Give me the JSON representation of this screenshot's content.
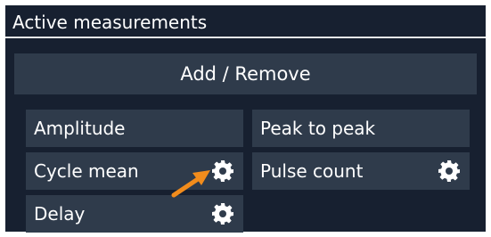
{
  "panel": {
    "title": "Active measurements"
  },
  "add_remove_label": "Add / Remove",
  "measurements": [
    {
      "label": "Amplitude",
      "has_settings": false
    },
    {
      "label": "Peak to peak",
      "has_settings": false
    },
    {
      "label": "Cycle mean",
      "has_settings": true
    },
    {
      "label": "Pulse count",
      "has_settings": true
    },
    {
      "label": "Delay",
      "has_settings": true
    }
  ],
  "colors": {
    "panel_background": "#172030",
    "button_background": "#2f3b4b",
    "text": "#ffffff",
    "callout_arrow": "#f28c1c"
  },
  "icons": {
    "settings": "gear-icon",
    "callout": "callout-arrow-icon"
  }
}
